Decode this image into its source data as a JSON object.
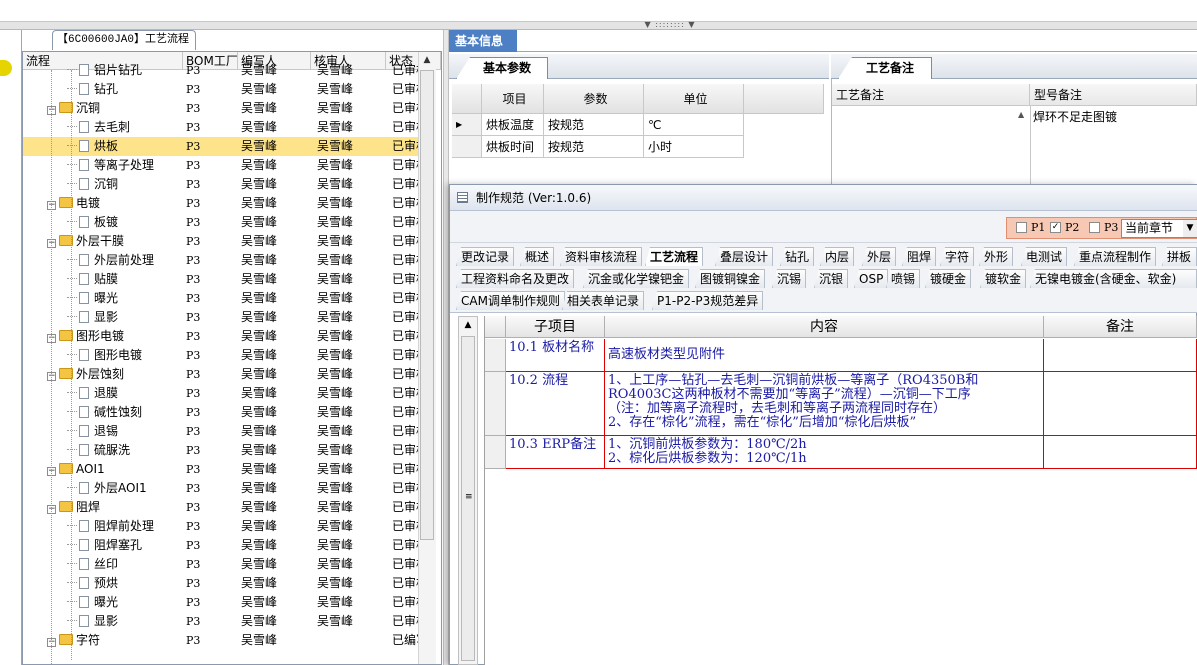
{
  "splitter_grip": "▼ :::::::: ▼",
  "left_tab": "【6C00600JA0】工艺流程",
  "tree": {
    "columns": [
      "流程",
      "BOM工厂",
      "编写人",
      "核审人",
      "状态"
    ],
    "rows": [
      {
        "level": 2,
        "type": "leaf",
        "name": "铝片钻孔",
        "bom": "P3",
        "author": "吴雪峰",
        "reviewer": "吴雪峰",
        "status": "已审核"
      },
      {
        "level": 2,
        "type": "leaf",
        "name": "钻孔",
        "bom": "P3",
        "author": "吴雪峰",
        "reviewer": "吴雪峰",
        "status": "已审核"
      },
      {
        "level": 1,
        "type": "folder",
        "name": "沉铜",
        "bom": "P3",
        "author": "吴雪峰",
        "reviewer": "吴雪峰",
        "status": "已审核"
      },
      {
        "level": 2,
        "type": "leaf",
        "name": "去毛刺",
        "bom": "P3",
        "author": "吴雪峰",
        "reviewer": "吴雪峰",
        "status": "已审核"
      },
      {
        "level": 2,
        "type": "leaf",
        "name": "烘板",
        "bom": "P3",
        "author": "吴雪峰",
        "reviewer": "吴雪峰",
        "status": "已审核",
        "selected": true
      },
      {
        "level": 2,
        "type": "leaf",
        "name": "等离子处理",
        "bom": "P3",
        "author": "吴雪峰",
        "reviewer": "吴雪峰",
        "status": "已审核"
      },
      {
        "level": 2,
        "type": "leaf",
        "name": "沉铜",
        "bom": "P3",
        "author": "吴雪峰",
        "reviewer": "吴雪峰",
        "status": "已审核"
      },
      {
        "level": 1,
        "type": "folder",
        "name": "电镀",
        "bom": "P3",
        "author": "吴雪峰",
        "reviewer": "吴雪峰",
        "status": "已审核"
      },
      {
        "level": 2,
        "type": "leaf",
        "name": "板镀",
        "bom": "P3",
        "author": "吴雪峰",
        "reviewer": "吴雪峰",
        "status": "已审核"
      },
      {
        "level": 1,
        "type": "folder",
        "name": "外层干膜",
        "bom": "P3",
        "author": "吴雪峰",
        "reviewer": "吴雪峰",
        "status": "已审核"
      },
      {
        "level": 2,
        "type": "leaf",
        "name": "外层前处理",
        "bom": "P3",
        "author": "吴雪峰",
        "reviewer": "吴雪峰",
        "status": "已审核"
      },
      {
        "level": 2,
        "type": "leaf",
        "name": "贴膜",
        "bom": "P3",
        "author": "吴雪峰",
        "reviewer": "吴雪峰",
        "status": "已审核"
      },
      {
        "level": 2,
        "type": "leaf",
        "name": "曝光",
        "bom": "P3",
        "author": "吴雪峰",
        "reviewer": "吴雪峰",
        "status": "已审核"
      },
      {
        "level": 2,
        "type": "leaf",
        "name": "显影",
        "bom": "P3",
        "author": "吴雪峰",
        "reviewer": "吴雪峰",
        "status": "已审核"
      },
      {
        "level": 1,
        "type": "folder",
        "name": "图形电镀",
        "bom": "P3",
        "author": "吴雪峰",
        "reviewer": "吴雪峰",
        "status": "已审核"
      },
      {
        "level": 2,
        "type": "leaf",
        "name": "图形电镀",
        "bom": "P3",
        "author": "吴雪峰",
        "reviewer": "吴雪峰",
        "status": "已审核"
      },
      {
        "level": 1,
        "type": "folder",
        "name": "外层蚀刻",
        "bom": "P3",
        "author": "吴雪峰",
        "reviewer": "吴雪峰",
        "status": "已审核"
      },
      {
        "level": 2,
        "type": "leaf",
        "name": "退膜",
        "bom": "P3",
        "author": "吴雪峰",
        "reviewer": "吴雪峰",
        "status": "已审核"
      },
      {
        "level": 2,
        "type": "leaf",
        "name": "碱性蚀刻",
        "bom": "P3",
        "author": "吴雪峰",
        "reviewer": "吴雪峰",
        "status": "已审核"
      },
      {
        "level": 2,
        "type": "leaf",
        "name": "退锡",
        "bom": "P3",
        "author": "吴雪峰",
        "reviewer": "吴雪峰",
        "status": "已审核"
      },
      {
        "level": 2,
        "type": "leaf",
        "name": "硫脲洗",
        "bom": "P3",
        "author": "吴雪峰",
        "reviewer": "吴雪峰",
        "status": "已审核"
      },
      {
        "level": 1,
        "type": "folder",
        "name": "AOI1",
        "bom": "P3",
        "author": "吴雪峰",
        "reviewer": "吴雪峰",
        "status": "已审核"
      },
      {
        "level": 2,
        "type": "leaf",
        "name": "外层AOI1",
        "bom": "P3",
        "author": "吴雪峰",
        "reviewer": "吴雪峰",
        "status": "已审核"
      },
      {
        "level": 1,
        "type": "folder",
        "name": "阻焊",
        "bom": "P3",
        "author": "吴雪峰",
        "reviewer": "吴雪峰",
        "status": "已审核"
      },
      {
        "level": 2,
        "type": "leaf",
        "name": "阻焊前处理",
        "bom": "P3",
        "author": "吴雪峰",
        "reviewer": "吴雪峰",
        "status": "已审核"
      },
      {
        "level": 2,
        "type": "leaf",
        "name": "阻焊塞孔",
        "bom": "P3",
        "author": "吴雪峰",
        "reviewer": "吴雪峰",
        "status": "已审核"
      },
      {
        "level": 2,
        "type": "leaf",
        "name": "丝印",
        "bom": "P3",
        "author": "吴雪峰",
        "reviewer": "吴雪峰",
        "status": "已审核"
      },
      {
        "level": 2,
        "type": "leaf",
        "name": "预烘",
        "bom": "P3",
        "author": "吴雪峰",
        "reviewer": "吴雪峰",
        "status": "已审核"
      },
      {
        "level": 2,
        "type": "leaf",
        "name": "曝光",
        "bom": "P3",
        "author": "吴雪峰",
        "reviewer": "吴雪峰",
        "status": "已审核"
      },
      {
        "level": 2,
        "type": "leaf",
        "name": "显影",
        "bom": "P3",
        "author": "吴雪峰",
        "reviewer": "吴雪峰",
        "status": "已审核"
      },
      {
        "level": 1,
        "type": "folder",
        "name": "字符",
        "bom": "P3",
        "author": "吴雪峰",
        "reviewer": "",
        "status": "已编写"
      }
    ]
  },
  "basic_info": {
    "tab": "基本信息",
    "params_tab": "基本参数",
    "params_columns": [
      "项目",
      "参数",
      "单位"
    ],
    "params_rows": [
      {
        "item": "烘板温度",
        "param": "按规范",
        "unit": "℃"
      },
      {
        "item": "烘板时间",
        "param": "按规范",
        "unit": "小时"
      }
    ],
    "notes_tab": "工艺备注",
    "notes_columns": [
      "工艺备注",
      "型号备注"
    ],
    "model_note": "焊环不足走图镀"
  },
  "dialog": {
    "title": "制作规范 (Ver:1.0.6)",
    "checks": [
      {
        "label": "P1",
        "checked": false
      },
      {
        "label": "P2",
        "checked": true
      },
      {
        "label": "P3",
        "checked": false
      }
    ],
    "section_select": "当前章节",
    "chapters_row1": [
      "更改记录",
      "概述",
      "资料审核流程",
      "工艺流程",
      "叠层设计",
      "钻孔",
      "内层",
      "外层",
      "阻焊",
      "字符",
      "外形",
      "电测试",
      "重点流程制作",
      "拼板"
    ],
    "chapters_row2": [
      "工程资料命名及更改",
      "沉金或化学镍钯金",
      "图镀铜镍金",
      "沉锡",
      "沉银",
      "OSP",
      "喷锡",
      "镀硬金",
      "镀软金",
      "无镍电镀金(含硬金、软金)"
    ],
    "chapters_row3": [
      "CAM调单制作规则",
      "相关表单记录",
      "P1-P2-P3规范差异"
    ],
    "active_chapter": "工艺流程",
    "grid_columns": [
      "子项目",
      "内容",
      "备注"
    ],
    "grid_rows": [
      {
        "sub": "10.1 板材名称",
        "content": [
          "高速板材类型见附件"
        ],
        "note": ""
      },
      {
        "sub": "10.2 流程",
        "content": [
          "1、上工序—钻孔—去毛刺—沉铜前烘板—等离子（RO4350B和",
          "RO4003C这两种板材不需要加“等离子”流程）—沉铜—下工序",
          "（注：加等离子流程时，去毛刺和等离子两流程同时存在）",
          "2、存在“棕化”流程，需在“棕化”后增加“棕化后烘板”"
        ],
        "note": ""
      },
      {
        "sub": "10.3 ERP备注",
        "content": [
          "1、沉铜前烘板参数为：180℃/2h",
          "2、棕化后烘板参数为：120℃/1h"
        ],
        "note": ""
      }
    ]
  }
}
